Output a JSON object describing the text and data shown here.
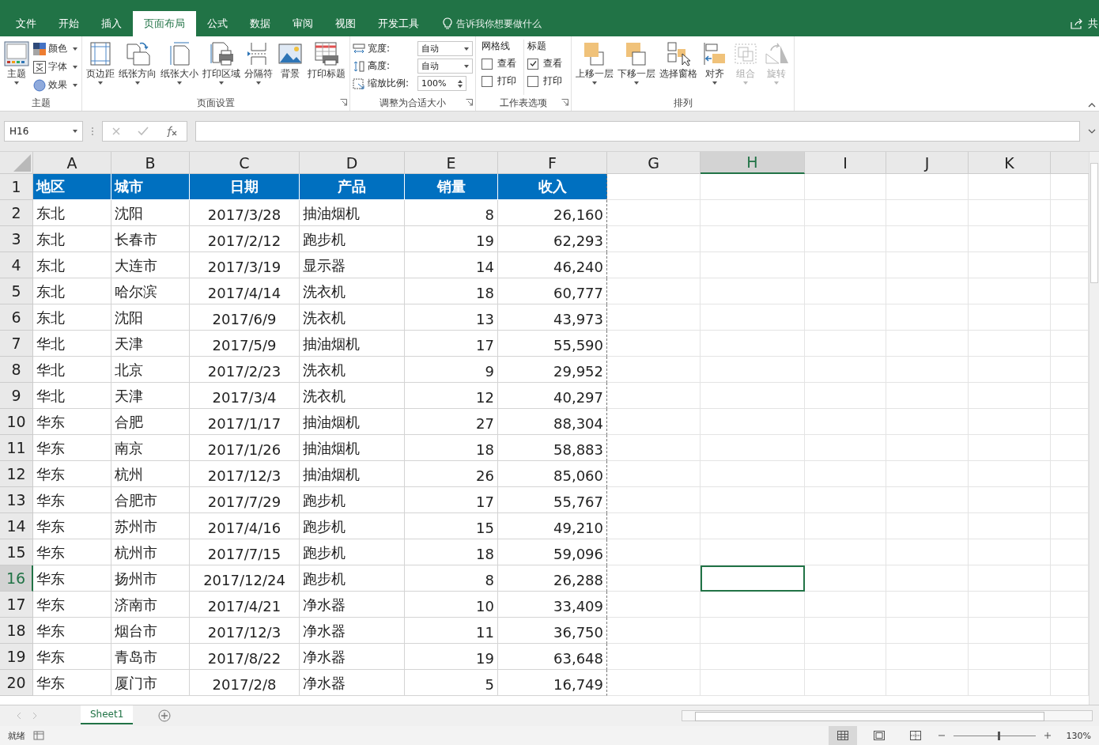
{
  "tabs": [
    {
      "label": "文件",
      "selected": false
    },
    {
      "label": "开始",
      "selected": false
    },
    {
      "label": "插入",
      "selected": false
    },
    {
      "label": "页面布局",
      "selected": true
    },
    {
      "label": "公式",
      "selected": false
    },
    {
      "label": "数据",
      "selected": false
    },
    {
      "label": "审阅",
      "selected": false
    },
    {
      "label": "视图",
      "selected": false
    },
    {
      "label": "开发工具",
      "selected": false
    }
  ],
  "tell_me": "告诉我你想要做什么",
  "share": "共",
  "ribbon": {
    "groups": [
      {
        "kind": "themes",
        "label": "主题",
        "big": "主题",
        "items": [
          {
            "kind": "colors",
            "label": "颜色"
          },
          {
            "kind": "fonts",
            "label": "字体"
          },
          {
            "kind": "effects",
            "label": "效果"
          }
        ]
      },
      {
        "kind": "buttons",
        "label": "页面设置",
        "launcher": true,
        "buttons": [
          {
            "kind": "margins",
            "label": "页边距",
            "dropdown": true,
            "disabled": false
          },
          {
            "kind": "orientation",
            "label": "纸张方向",
            "dropdown": true,
            "disabled": false
          },
          {
            "kind": "size",
            "label": "纸张大小",
            "dropdown": true,
            "disabled": false
          },
          {
            "kind": "print_area",
            "label": "打印区域",
            "dropdown": true,
            "disabled": false
          },
          {
            "kind": "breaks",
            "label": "分隔符",
            "dropdown": true,
            "disabled": false
          },
          {
            "kind": "background",
            "label": "背景",
            "dropdown": false,
            "disabled": false
          },
          {
            "kind": "print_titles",
            "label": "打印标题",
            "dropdown": false,
            "disabled": false
          }
        ]
      },
      {
        "kind": "scale",
        "label": "调整为合适大小",
        "launcher": true,
        "fields": [
          {
            "kind": "width",
            "label": "宽度:",
            "value": "自动"
          },
          {
            "kind": "height",
            "label": "高度:",
            "value": "自动"
          },
          {
            "kind": "scale",
            "label": "缩放比例:",
            "value": "100%"
          }
        ]
      },
      {
        "kind": "sheet_options",
        "label": "工作表选项",
        "launcher": true,
        "columns": [
          {
            "title": "网格线",
            "options": [
              {
                "label": "查看",
                "checked": false
              },
              {
                "label": "打印",
                "checked": false
              }
            ]
          },
          {
            "title": "标题",
            "options": [
              {
                "label": "查看",
                "checked": true
              },
              {
                "label": "打印",
                "checked": false
              }
            ]
          }
        ]
      },
      {
        "kind": "buttons",
        "label": "排列",
        "launcher": false,
        "buttons": [
          {
            "kind": "bring_forward",
            "label": "上移一层",
            "dropdown": true,
            "disabled": false
          },
          {
            "kind": "send_backward",
            "label": "下移一层",
            "dropdown": true,
            "disabled": false
          },
          {
            "kind": "selection_pane",
            "label": "选择窗格",
            "dropdown": false,
            "disabled": false
          },
          {
            "kind": "align",
            "label": "对齐",
            "dropdown": true,
            "disabled": false
          },
          {
            "kind": "group",
            "label": "组合",
            "dropdown": true,
            "disabled": true
          },
          {
            "kind": "rotate",
            "label": "旋转",
            "dropdown": true,
            "disabled": true
          }
        ]
      }
    ]
  },
  "formula_bar": {
    "name_box": "H16"
  },
  "columns": [
    {
      "label": "A",
      "selected": false
    },
    {
      "label": "B",
      "selected": false
    },
    {
      "label": "C",
      "selected": false
    },
    {
      "label": "D",
      "selected": false
    },
    {
      "label": "E",
      "selected": false
    },
    {
      "label": "F",
      "selected": false
    },
    {
      "label": "G",
      "selected": false
    },
    {
      "label": "H",
      "selected": true
    },
    {
      "label": "I",
      "selected": false
    },
    {
      "label": "J",
      "selected": false
    },
    {
      "label": "K",
      "selected": false
    }
  ],
  "header_row": [
    "地区",
    "城市",
    "日期",
    "产品",
    "销量",
    "收入"
  ],
  "rows": [
    {
      "num": "2",
      "selected": false,
      "cells": [
        "东北",
        "沈阳",
        "2017/3/28",
        "抽油烟机",
        "8",
        "26,160"
      ]
    },
    {
      "num": "3",
      "selected": false,
      "cells": [
        "东北",
        "长春市",
        "2017/2/12",
        "跑步机",
        "19",
        "62,293"
      ]
    },
    {
      "num": "4",
      "selected": false,
      "cells": [
        "东北",
        "大连市",
        "2017/3/19",
        "显示器",
        "14",
        "46,240"
      ]
    },
    {
      "num": "5",
      "selected": false,
      "cells": [
        "东北",
        "哈尔滨",
        "2017/4/14",
        "洗衣机",
        "18",
        "60,777"
      ]
    },
    {
      "num": "6",
      "selected": false,
      "cells": [
        "东北",
        "沈阳",
        "2017/6/9",
        "洗衣机",
        "13",
        "43,973"
      ]
    },
    {
      "num": "7",
      "selected": false,
      "cells": [
        "华北",
        "天津",
        "2017/5/9",
        "抽油烟机",
        "17",
        "55,590"
      ]
    },
    {
      "num": "8",
      "selected": false,
      "cells": [
        "华北",
        "北京",
        "2017/2/23",
        "洗衣机",
        "9",
        "29,952"
      ]
    },
    {
      "num": "9",
      "selected": false,
      "cells": [
        "华北",
        "天津",
        "2017/3/4",
        "洗衣机",
        "12",
        "40,297"
      ]
    },
    {
      "num": "10",
      "selected": false,
      "cells": [
        "华东",
        "合肥",
        "2017/1/17",
        "抽油烟机",
        "27",
        "88,304"
      ]
    },
    {
      "num": "11",
      "selected": false,
      "cells": [
        "华东",
        "南京",
        "2017/1/26",
        "抽油烟机",
        "18",
        "58,883"
      ]
    },
    {
      "num": "12",
      "selected": false,
      "cells": [
        "华东",
        "杭州",
        "2017/12/3",
        "抽油烟机",
        "26",
        "85,060"
      ]
    },
    {
      "num": "13",
      "selected": false,
      "cells": [
        "华东",
        "合肥市",
        "2017/7/29",
        "跑步机",
        "17",
        "55,767"
      ]
    },
    {
      "num": "14",
      "selected": false,
      "cells": [
        "华东",
        "苏州市",
        "2017/4/16",
        "跑步机",
        "15",
        "49,210"
      ]
    },
    {
      "num": "15",
      "selected": false,
      "cells": [
        "华东",
        "杭州市",
        "2017/7/15",
        "跑步机",
        "18",
        "59,096"
      ]
    },
    {
      "num": "16",
      "selected": true,
      "cells": [
        "华东",
        "扬州市",
        "2017/12/24",
        "跑步机",
        "8",
        "26,288"
      ]
    },
    {
      "num": "17",
      "selected": false,
      "cells": [
        "华东",
        "济南市",
        "2017/4/21",
        "净水器",
        "10",
        "33,409"
      ]
    },
    {
      "num": "18",
      "selected": false,
      "cells": [
        "华东",
        "烟台市",
        "2017/12/3",
        "净水器",
        "11",
        "36,750"
      ]
    },
    {
      "num": "19",
      "selected": false,
      "cells": [
        "华东",
        "青岛市",
        "2017/8/22",
        "净水器",
        "19",
        "63,648"
      ]
    },
    {
      "num": "20",
      "selected": false,
      "cells": [
        "华东",
        "厦门市",
        "2017/2/8",
        "净水器",
        "5",
        "16,749"
      ]
    }
  ],
  "header_row_num": "1",
  "sheets": [
    {
      "label": "Sheet1",
      "selected": true
    }
  ],
  "status": {
    "text": "就绪",
    "zoom": "130%",
    "zoom_slider": {
      "level": 0.55
    },
    "views": [
      {
        "kind": "normal",
        "selected": true
      },
      {
        "kind": "page_layout",
        "selected": false
      },
      {
        "kind": "page_break",
        "selected": false
      }
    ]
  }
}
